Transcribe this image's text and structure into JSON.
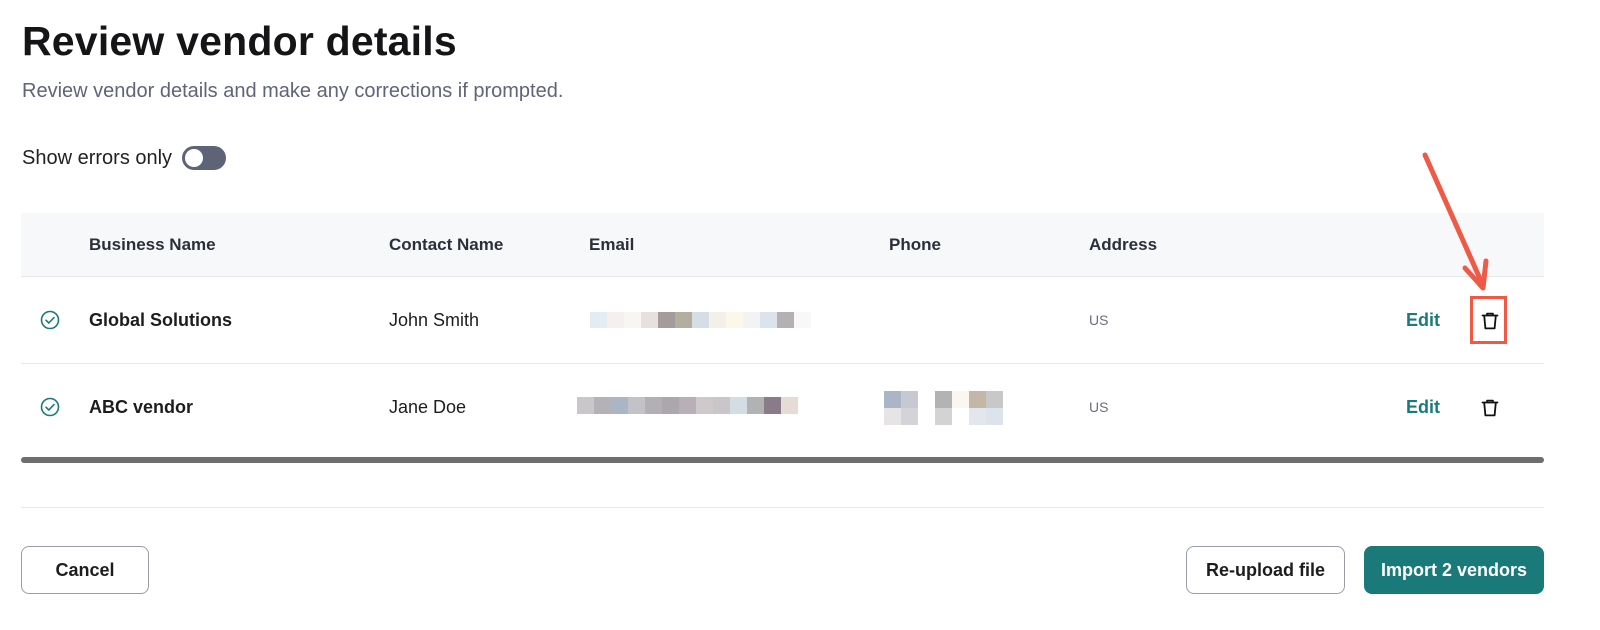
{
  "page": {
    "title": "Review vendor details",
    "subtitle": "Review vendor details and make any corrections if prompted."
  },
  "filter": {
    "show_errors_label": "Show errors only",
    "show_errors_on": false
  },
  "table": {
    "columns": [
      "Business Name",
      "Contact Name",
      "Email",
      "Phone",
      "Address"
    ],
    "rows": [
      {
        "business_name": "Global Solutions",
        "contact_name": "John Smith",
        "address": "US",
        "edit_label": "Edit",
        "status": "valid"
      },
      {
        "business_name": "ABC vendor",
        "contact_name": "Jane Doe",
        "address": "US",
        "edit_label": "Edit",
        "status": "valid"
      }
    ]
  },
  "footer": {
    "cancel_label": "Cancel",
    "reupload_label": "Re-upload file",
    "import_label": "Import 2 vendors"
  },
  "icons": {
    "status": "check-circle-icon",
    "delete": "trash-icon",
    "annotation": "arrow-icon"
  },
  "colors": {
    "accent": "#1a7a7a",
    "toggle_off": "#5f6377",
    "annotation": "#ee5a45"
  }
}
